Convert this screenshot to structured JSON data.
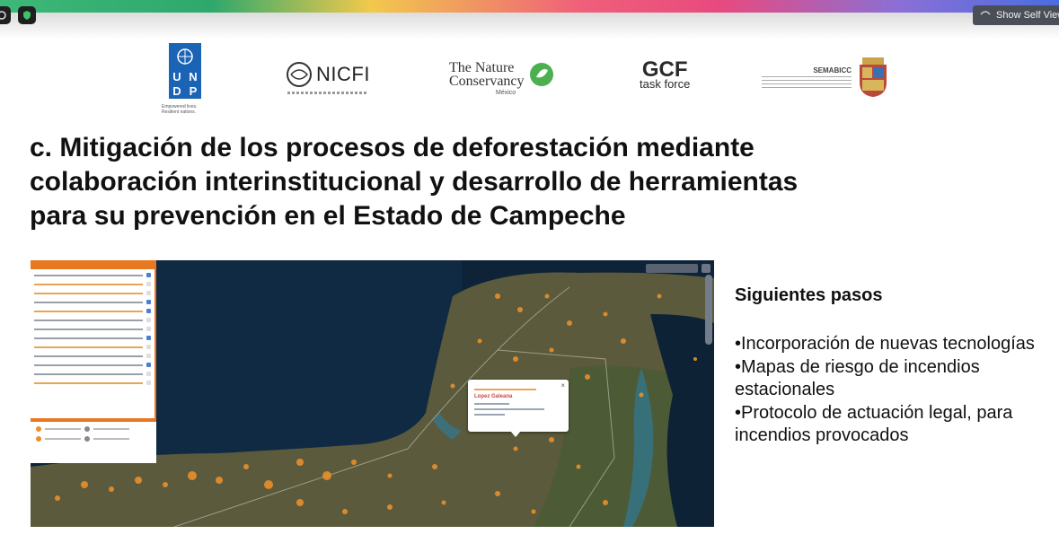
{
  "window": {
    "self_view_label": "Show Self View"
  },
  "logos": {
    "undp_letters": [
      "U",
      "N",
      "D",
      "P"
    ],
    "undp_caption": "Empowered lives. Resilient nations.",
    "nicfi": "NICFI",
    "tnc_line1": "The Nature",
    "tnc_line2": "Conservancy",
    "tnc_country": "México",
    "gcf_big": "GCF",
    "gcf_small": "task force",
    "sema_title": "SEMABICC"
  },
  "slide": {
    "heading_line1": "c. Mitigación de los procesos de deforestación mediante",
    "heading_line2": "colaboración interinstitucional y desarrollo de herramientas",
    "heading_line3": "para su prevención en  el Estado de Campeche",
    "next_steps_title": "Siguientes pasos",
    "bullets": [
      "•Incorporación de nuevas tecnologías",
      "•Mapas de riesgo de incendios estacionales",
      "•Protocolo de actuación legal, para incendios provocados"
    ]
  },
  "map": {
    "sea_color": "#0f2338",
    "land_color": "#5b5a3c",
    "panel_accent": "#e87722",
    "fire_point_color": "#e8902b",
    "popup_title": "Lopez Galeana"
  }
}
